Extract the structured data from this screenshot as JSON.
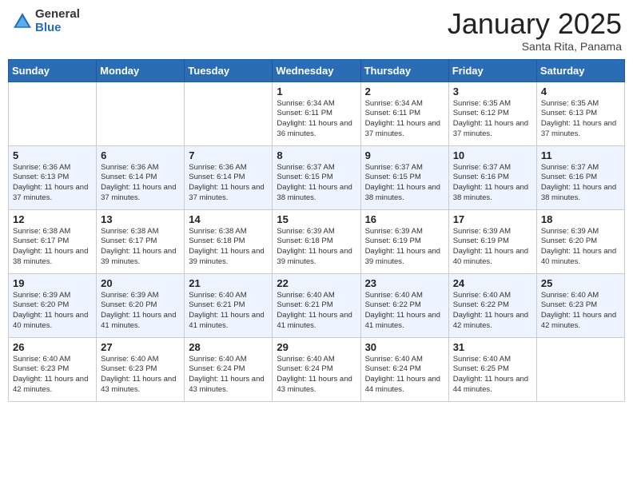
{
  "header": {
    "logo_general": "General",
    "logo_blue": "Blue",
    "month_title": "January 2025",
    "subtitle": "Santa Rita, Panama"
  },
  "days_of_week": [
    "Sunday",
    "Monday",
    "Tuesday",
    "Wednesday",
    "Thursday",
    "Friday",
    "Saturday"
  ],
  "weeks": [
    [
      {
        "day": "",
        "info": ""
      },
      {
        "day": "",
        "info": ""
      },
      {
        "day": "",
        "info": ""
      },
      {
        "day": "1",
        "info": "Sunrise: 6:34 AM\nSunset: 6:11 PM\nDaylight: 11 hours and 36 minutes."
      },
      {
        "day": "2",
        "info": "Sunrise: 6:34 AM\nSunset: 6:11 PM\nDaylight: 11 hours and 37 minutes."
      },
      {
        "day": "3",
        "info": "Sunrise: 6:35 AM\nSunset: 6:12 PM\nDaylight: 11 hours and 37 minutes."
      },
      {
        "day": "4",
        "info": "Sunrise: 6:35 AM\nSunset: 6:13 PM\nDaylight: 11 hours and 37 minutes."
      }
    ],
    [
      {
        "day": "5",
        "info": "Sunrise: 6:36 AM\nSunset: 6:13 PM\nDaylight: 11 hours and 37 minutes."
      },
      {
        "day": "6",
        "info": "Sunrise: 6:36 AM\nSunset: 6:14 PM\nDaylight: 11 hours and 37 minutes."
      },
      {
        "day": "7",
        "info": "Sunrise: 6:36 AM\nSunset: 6:14 PM\nDaylight: 11 hours and 37 minutes."
      },
      {
        "day": "8",
        "info": "Sunrise: 6:37 AM\nSunset: 6:15 PM\nDaylight: 11 hours and 38 minutes."
      },
      {
        "day": "9",
        "info": "Sunrise: 6:37 AM\nSunset: 6:15 PM\nDaylight: 11 hours and 38 minutes."
      },
      {
        "day": "10",
        "info": "Sunrise: 6:37 AM\nSunset: 6:16 PM\nDaylight: 11 hours and 38 minutes."
      },
      {
        "day": "11",
        "info": "Sunrise: 6:37 AM\nSunset: 6:16 PM\nDaylight: 11 hours and 38 minutes."
      }
    ],
    [
      {
        "day": "12",
        "info": "Sunrise: 6:38 AM\nSunset: 6:17 PM\nDaylight: 11 hours and 38 minutes."
      },
      {
        "day": "13",
        "info": "Sunrise: 6:38 AM\nSunset: 6:17 PM\nDaylight: 11 hours and 39 minutes."
      },
      {
        "day": "14",
        "info": "Sunrise: 6:38 AM\nSunset: 6:18 PM\nDaylight: 11 hours and 39 minutes."
      },
      {
        "day": "15",
        "info": "Sunrise: 6:39 AM\nSunset: 6:18 PM\nDaylight: 11 hours and 39 minutes."
      },
      {
        "day": "16",
        "info": "Sunrise: 6:39 AM\nSunset: 6:19 PM\nDaylight: 11 hours and 39 minutes."
      },
      {
        "day": "17",
        "info": "Sunrise: 6:39 AM\nSunset: 6:19 PM\nDaylight: 11 hours and 40 minutes."
      },
      {
        "day": "18",
        "info": "Sunrise: 6:39 AM\nSunset: 6:20 PM\nDaylight: 11 hours and 40 minutes."
      }
    ],
    [
      {
        "day": "19",
        "info": "Sunrise: 6:39 AM\nSunset: 6:20 PM\nDaylight: 11 hours and 40 minutes."
      },
      {
        "day": "20",
        "info": "Sunrise: 6:39 AM\nSunset: 6:20 PM\nDaylight: 11 hours and 41 minutes."
      },
      {
        "day": "21",
        "info": "Sunrise: 6:40 AM\nSunset: 6:21 PM\nDaylight: 11 hours and 41 minutes."
      },
      {
        "day": "22",
        "info": "Sunrise: 6:40 AM\nSunset: 6:21 PM\nDaylight: 11 hours and 41 minutes."
      },
      {
        "day": "23",
        "info": "Sunrise: 6:40 AM\nSunset: 6:22 PM\nDaylight: 11 hours and 41 minutes."
      },
      {
        "day": "24",
        "info": "Sunrise: 6:40 AM\nSunset: 6:22 PM\nDaylight: 11 hours and 42 minutes."
      },
      {
        "day": "25",
        "info": "Sunrise: 6:40 AM\nSunset: 6:23 PM\nDaylight: 11 hours and 42 minutes."
      }
    ],
    [
      {
        "day": "26",
        "info": "Sunrise: 6:40 AM\nSunset: 6:23 PM\nDaylight: 11 hours and 42 minutes."
      },
      {
        "day": "27",
        "info": "Sunrise: 6:40 AM\nSunset: 6:23 PM\nDaylight: 11 hours and 43 minutes."
      },
      {
        "day": "28",
        "info": "Sunrise: 6:40 AM\nSunset: 6:24 PM\nDaylight: 11 hours and 43 minutes."
      },
      {
        "day": "29",
        "info": "Sunrise: 6:40 AM\nSunset: 6:24 PM\nDaylight: 11 hours and 43 minutes."
      },
      {
        "day": "30",
        "info": "Sunrise: 6:40 AM\nSunset: 6:24 PM\nDaylight: 11 hours and 44 minutes."
      },
      {
        "day": "31",
        "info": "Sunrise: 6:40 AM\nSunset: 6:25 PM\nDaylight: 11 hours and 44 minutes."
      },
      {
        "day": "",
        "info": ""
      }
    ]
  ]
}
